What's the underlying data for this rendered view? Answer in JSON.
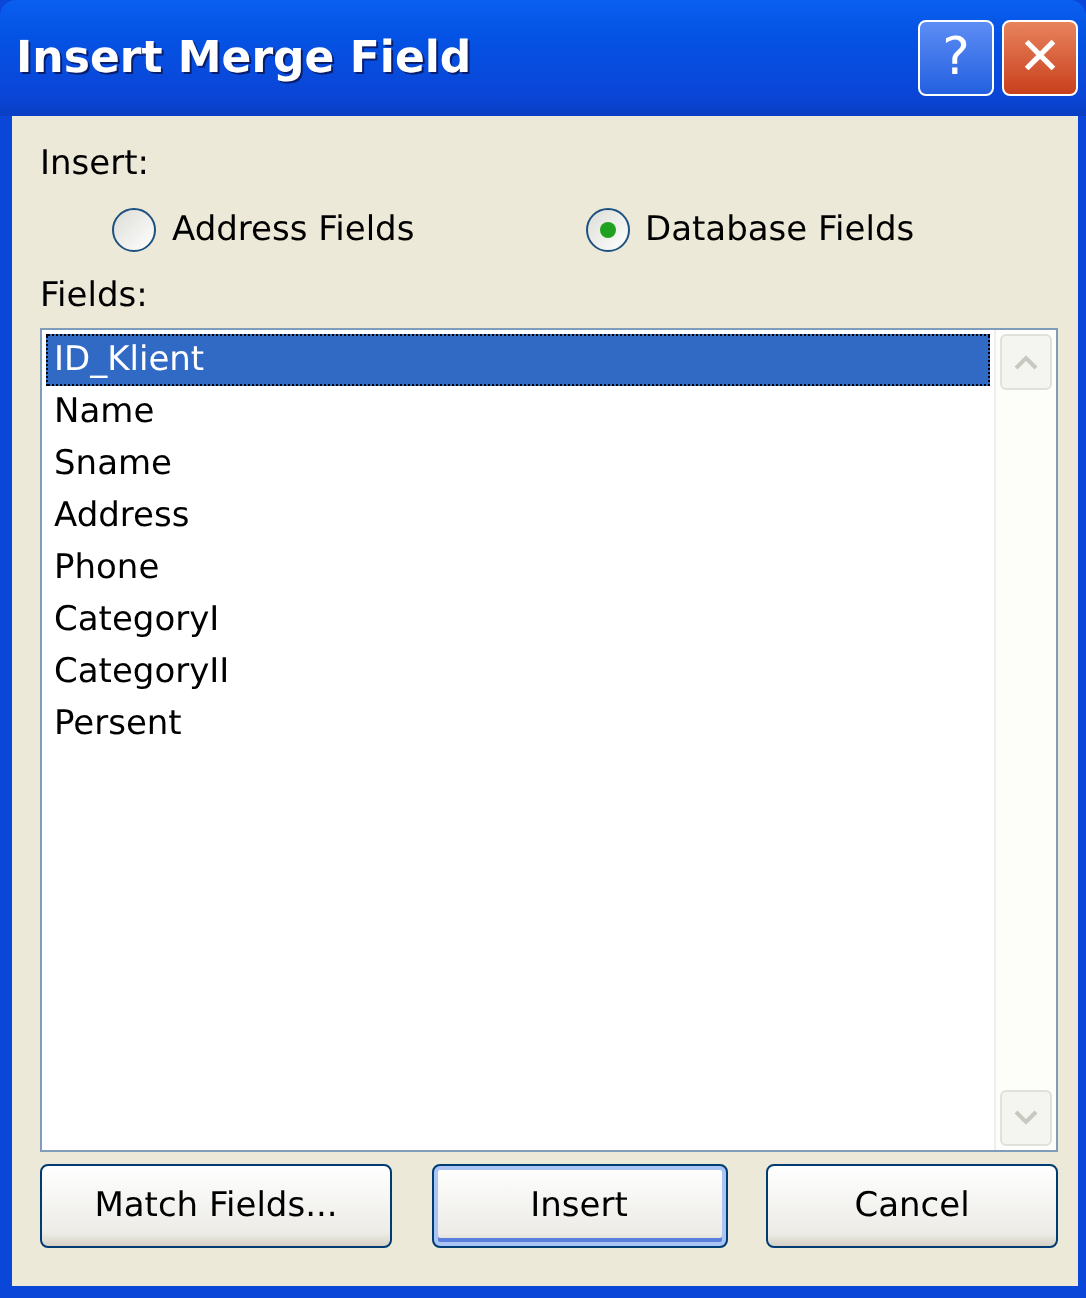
{
  "window": {
    "title": "Insert Merge Field",
    "help": "?",
    "close": "✕"
  },
  "insert_group": {
    "label": "Insert:",
    "options": [
      {
        "label": "Address Fields",
        "selected": false
      },
      {
        "label": "Database Fields",
        "selected": true
      }
    ]
  },
  "fields": {
    "label": "Fields:",
    "items": [
      {
        "label": "ID_Klient",
        "selected": true
      },
      {
        "label": "Name",
        "selected": false
      },
      {
        "label": "Sname",
        "selected": false
      },
      {
        "label": "Address",
        "selected": false
      },
      {
        "label": "Phone",
        "selected": false
      },
      {
        "label": "CategoryI",
        "selected": false
      },
      {
        "label": "CategoryII",
        "selected": false
      },
      {
        "label": "Persent",
        "selected": false
      }
    ]
  },
  "buttons": [
    {
      "label": "Match Fields...",
      "default": false
    },
    {
      "label": "Insert",
      "default": true
    },
    {
      "label": "Cancel",
      "default": false
    }
  ]
}
